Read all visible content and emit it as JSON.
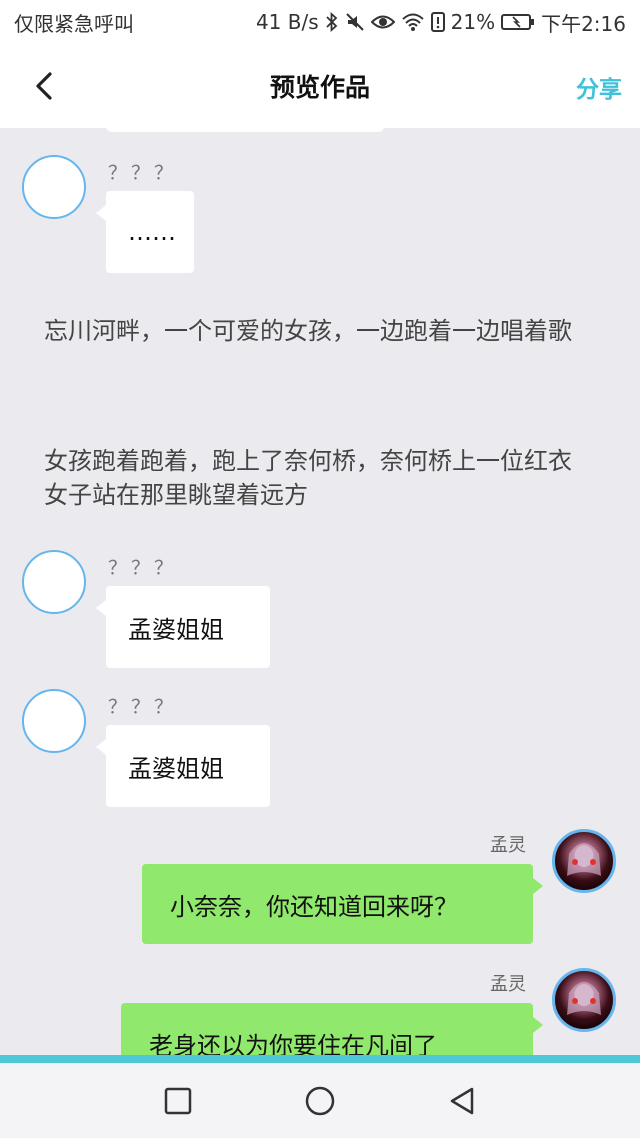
{
  "status": {
    "carrier": "仅限紧急呼叫",
    "speed": "41 B/s",
    "battery": "21%",
    "time": "下午2:16"
  },
  "header": {
    "title": "预览作品",
    "share_label": "分享"
  },
  "messages": {
    "m1": {
      "name": "？？？",
      "text": "……"
    },
    "narr1": "忘川河畔，一个可爱的女孩，一边跑着一边唱着歌",
    "narr2": "女孩跑着跑着，跑上了奈何桥，奈何桥上一位红衣女子站在那里眺望着远方",
    "m2": {
      "name": "？？？",
      "text": "孟婆姐姐"
    },
    "m3": {
      "name": "？？？",
      "text": "孟婆姐姐"
    },
    "m4": {
      "name": "孟灵",
      "text": "小奈奈，你还知道回来呀？"
    },
    "m5": {
      "name": "孟灵",
      "text": "老身还以为你要住在凡间了"
    }
  },
  "icons": {
    "back": "chevron-left-icon",
    "bluetooth": "bluetooth-icon",
    "mute": "mute-icon",
    "eye": "eye-icon",
    "wifi": "wifi-icon",
    "battery": "battery-icon",
    "nav_recent": "square-icon",
    "nav_home": "circle-icon",
    "nav_back": "triangle-back-icon"
  },
  "colors": {
    "accent": "#3fc1d9",
    "bubble_right": "#90e86c",
    "avatar_border": "#66b5ee"
  }
}
